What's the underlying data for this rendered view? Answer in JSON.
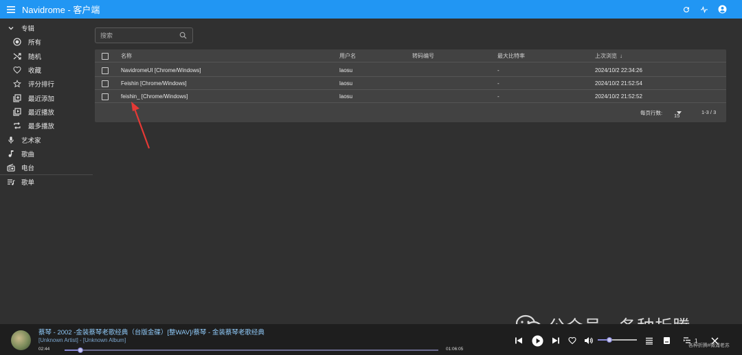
{
  "app": {
    "title": "Navidrome - 客户端"
  },
  "sidebar": {
    "albums_label": "专辑",
    "album_items": [
      {
        "label": "所有",
        "icon": "radio-button-icon"
      },
      {
        "label": "随机",
        "icon": "shuffle-icon"
      },
      {
        "label": "收藏",
        "icon": "heart-icon"
      },
      {
        "label": "评分排行",
        "icon": "star-icon"
      },
      {
        "label": "最近添加",
        "icon": "library-add-icon"
      },
      {
        "label": "最近播放",
        "icon": "library-play-icon"
      },
      {
        "label": "最多播放",
        "icon": "repeat-icon"
      }
    ],
    "artists_label": "艺术家",
    "songs_label": "歌曲",
    "radio_label": "电台",
    "playlists_label": "歌单"
  },
  "search": {
    "placeholder": "搜索"
  },
  "table": {
    "headers": {
      "name": "名称",
      "user": "用户名",
      "transcode": "转码编号",
      "max_bitrate": "最大比特率",
      "last_seen": "上次浏览",
      "sort_arrow": "↓"
    },
    "rows": [
      {
        "name": "NavidromeUI [Chrome/Windows]",
        "user": "laosu",
        "transcode": "",
        "max_bitrate": "-",
        "last_seen": "2024/10/2 22:34:26"
      },
      {
        "name": "Feishin [Chrome/Windows]",
        "user": "laosu",
        "transcode": "",
        "max_bitrate": "-",
        "last_seen": "2024/10/2 21:52:54"
      },
      {
        "name": "feishin_ [Chrome/Windows]",
        "user": "laosu",
        "transcode": "",
        "max_bitrate": "-",
        "last_seen": "2024/10/2 21:52:52"
      }
    ],
    "rows_per_page_label": "每页行数:",
    "rows_per_page_value": "15",
    "range": "1-3 / 3"
  },
  "player": {
    "track": "蔡琴 - 2002 -金装蔡琴老歌经典（台版金碟）[整WAV]/蔡琴 - 金装蔡琴老歌经典",
    "artist_album": "[Unknown Artist] - [Unknown Album]",
    "current_time": "02:44",
    "total_time": "01:06:05",
    "progress_fraction": 0.043,
    "volume_fraction": 0.3,
    "queue_count": "1"
  },
  "watermark": {
    "text": "公众号 · 各种折腾",
    "small": "各种折腾#微浦老苏"
  },
  "colors": {
    "appbar": "#2196f3",
    "accent_link": "#90caf9",
    "annotation": "#e53935"
  }
}
